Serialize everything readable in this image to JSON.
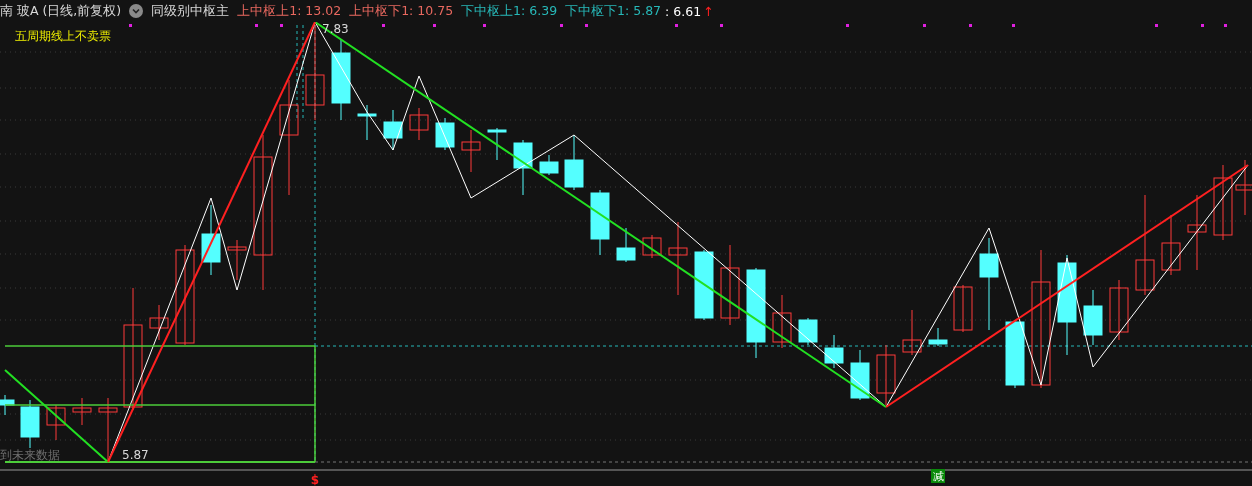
{
  "header": {
    "stock_title": "南 玻A (日线,前复权)",
    "indicator_name": "同级别中枢主",
    "values": [
      {
        "label": "上中枢上1: 13.02",
        "color": "#e8685f"
      },
      {
        "label": "上中枢下1: 10.75",
        "color": "#e8685f"
      },
      {
        "label": "下中枢上1: 6.39",
        "color": "#27b8b8"
      },
      {
        "label": "下中枢下1: 5.87",
        "color": "#27b8b8"
      }
    ],
    "last_value": ": 6.61",
    "arrow": "↑"
  },
  "chart": {
    "note": "五周期线上不卖票",
    "warning": "到未来数据",
    "high_label": "7.83",
    "low_label": "5.87",
    "signals": [
      {
        "kind": "dollar",
        "text": "$"
      },
      {
        "kind": "reduce",
        "text": "减"
      }
    ]
  }
}
